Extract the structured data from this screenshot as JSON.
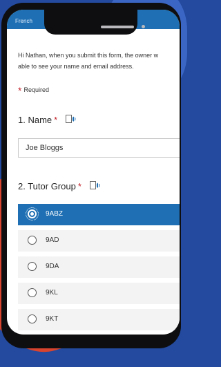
{
  "language": {
    "label": "French"
  },
  "form": {
    "intro_line1": "Hi Nathan, when you submit this form, the owner w",
    "intro_line2": "able to see your name and email address.",
    "required_star": "*",
    "required_label": "Required",
    "questions": [
      {
        "title": "1. Name",
        "star": "*",
        "value": "Joe Bloggs"
      },
      {
        "title": "2. Tutor Group",
        "star": "*"
      }
    ],
    "tutor_group_options": [
      {
        "label": "9ABZ",
        "selected": true
      },
      {
        "label": "9AD",
        "selected": false
      },
      {
        "label": "9DA",
        "selected": false
      },
      {
        "label": "9KL",
        "selected": false
      },
      {
        "label": "9KT",
        "selected": false
      }
    ]
  },
  "colors": {
    "accent": "#1e6fb3",
    "required": "#c4262e",
    "background": "#234a9e"
  },
  "icons": {
    "read_aloud": "immersive-reader-icon",
    "radio": "radio-button-icon"
  }
}
